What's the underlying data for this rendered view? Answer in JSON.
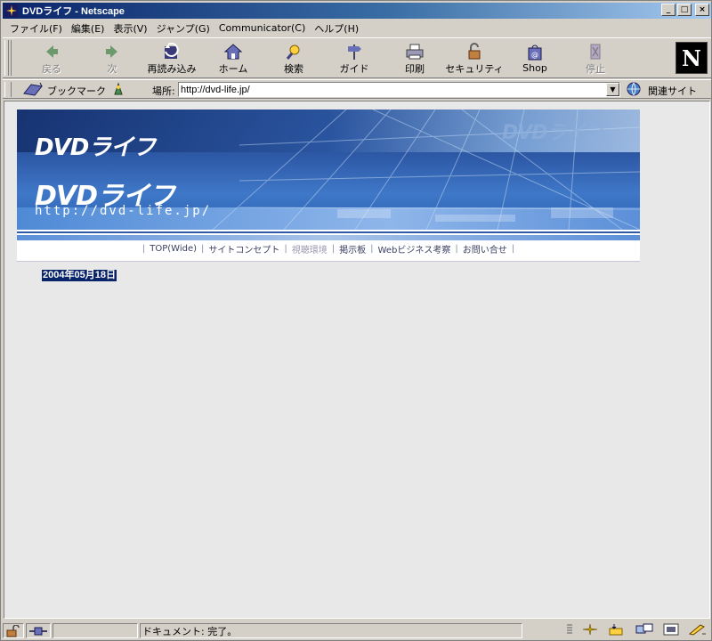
{
  "window": {
    "title": "DVDライフ - Netscape",
    "controls": {
      "minimize": "_",
      "maximize": "□",
      "close": "×"
    }
  },
  "menu": [
    "ファイル(F)",
    "編集(E)",
    "表示(V)",
    "ジャンプ(G)",
    "Communicator(C)",
    "ヘルプ(H)"
  ],
  "toolbar": {
    "back": "戻る",
    "forward": "次",
    "reload": "再読み込み",
    "home": "ホーム",
    "search": "検索",
    "guide": "ガイド",
    "print": "印刷",
    "security": "セキュリティ",
    "shop": "Shop",
    "stop": "停止",
    "logo": "N"
  },
  "location": {
    "bookmarks": "ブックマーク",
    "label": "場所:",
    "url": "http://dvd-life.jp/",
    "related": "関連サイト"
  },
  "banner": {
    "logo_small": "DVDライフ",
    "logo_large": "DVDライフ",
    "logo_ghost": "DVDライフ",
    "url": "http://dvd-life.jp/"
  },
  "nav": [
    {
      "label": "TOP(Wide)",
      "dim": false
    },
    {
      "label": "サイトコンセプト",
      "dim": false
    },
    {
      "label": "視聴環境",
      "dim": true
    },
    {
      "label": "掲示板",
      "dim": false
    },
    {
      "label": "Webビジネス考察",
      "dim": false
    },
    {
      "label": "お問い合せ",
      "dim": false
    }
  ],
  "nav_separator": "|",
  "content": {
    "date": "2004年05月18日"
  },
  "status": {
    "text": "ドキュメント: 完了。"
  },
  "colors": {
    "titlebar": "#0a246a",
    "selection": "#0a246a",
    "chrome": "#d4d0c8",
    "page_bg": "#e8e8e8",
    "banner_blue": "#2e5aa8"
  }
}
